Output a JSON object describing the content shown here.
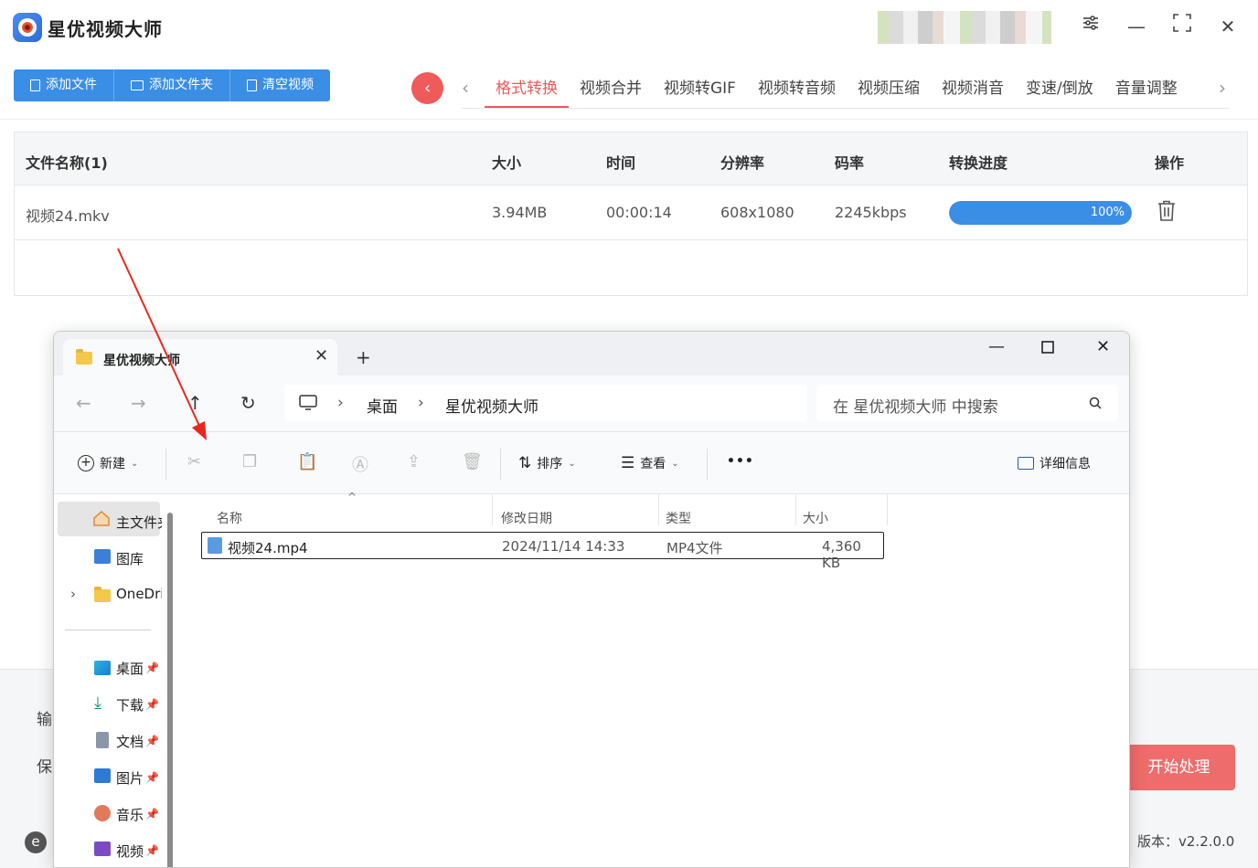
{
  "app": {
    "title": "星优视频大师",
    "toolbar": {
      "add_file": "添加文件",
      "add_folder": "添加文件夹",
      "clear_video": "清空视频"
    },
    "tabs": [
      "格式转换",
      "视频合并",
      "视频转GIF",
      "视频转音频",
      "视频压缩",
      "视频消音",
      "变速/倒放",
      "音量调整"
    ],
    "active_tab": "格式转换",
    "table": {
      "headers": {
        "name": "文件名称(1)",
        "size": "大小",
        "time": "时间",
        "resolution": "分辨率",
        "bitrate": "码率",
        "progress": "转换进度",
        "action": "操作"
      },
      "rows": [
        {
          "name": "视频24.mkv",
          "size": "3.94MB",
          "time": "00:00:14",
          "resolution": "608x1080",
          "bitrate": "2245kbps",
          "progress_text": "100%",
          "progress_value": 1.0
        }
      ]
    },
    "bottom": {
      "output_label": "输",
      "save_label": "保",
      "start_button": "开始处理",
      "version": "版本：v2.2.0.0"
    },
    "accent_blue": "#3a8ee6",
    "accent_red": "#ef5a5a"
  },
  "explorer": {
    "tab_title": "星优视频大师",
    "breadcrumb": [
      "桌面",
      "星优视频大师"
    ],
    "search_placeholder": "在 星优视频大师 中搜索",
    "toolbar": {
      "new": "新建",
      "sort": "排序",
      "view": "查看",
      "more": "•••",
      "details": "详细信息"
    },
    "sidebar": {
      "home": "主文件夹",
      "gallery": "图库",
      "onedrive": "OneDrive",
      "quick": [
        "桌面",
        "下载",
        "文档",
        "图片",
        "音乐",
        "视频"
      ]
    },
    "columns": {
      "name": "名称",
      "modified": "修改日期",
      "type": "类型",
      "size": "大小"
    },
    "files": [
      {
        "name": "视频24.mp4",
        "modified": "2024/11/14 14:33",
        "type": "MP4文件",
        "size": "4,360 KB"
      }
    ]
  }
}
